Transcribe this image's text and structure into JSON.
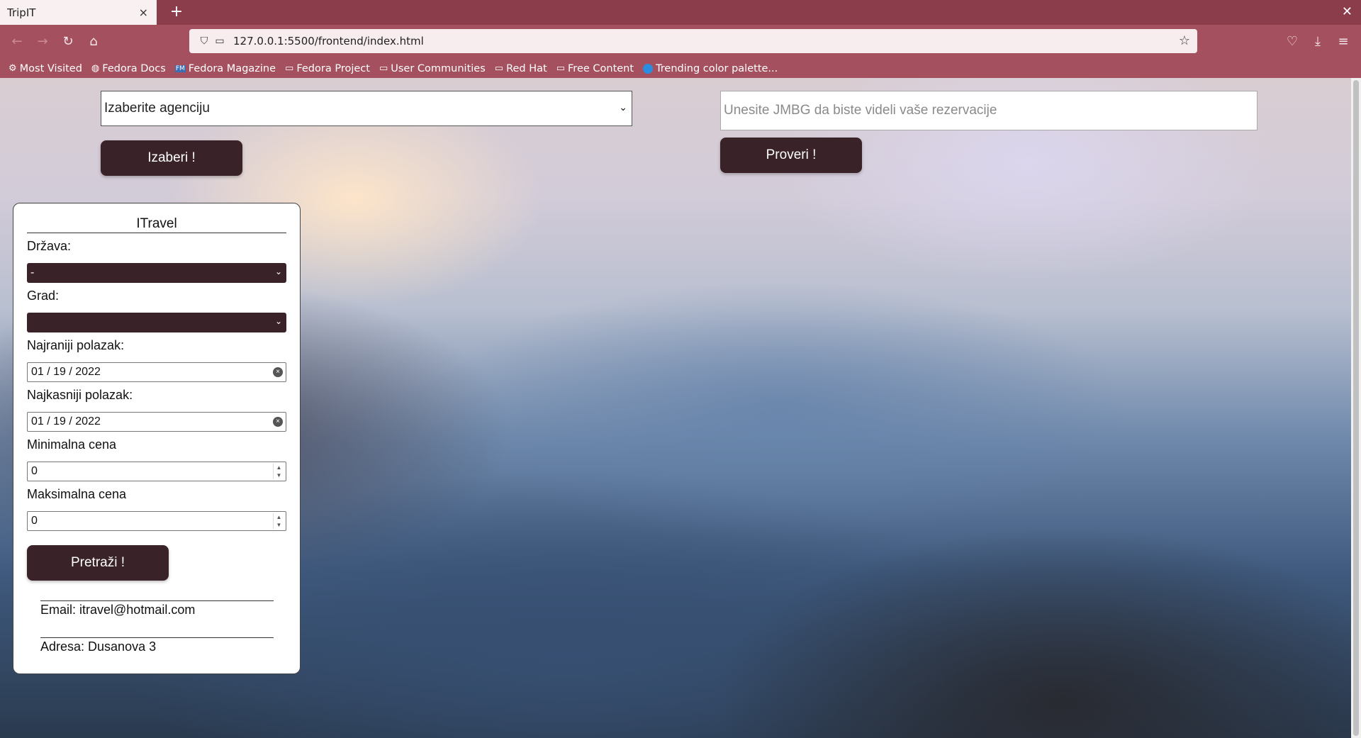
{
  "browser": {
    "tab_title": "TripIT",
    "tab_close": "×",
    "new_tab": "+",
    "window_close": "✕",
    "url": "127.0.0.1:5500/frontend/index.html",
    "bookmarks": [
      {
        "label": "Most Visited",
        "icon": "gear-icon"
      },
      {
        "label": "Fedora Docs",
        "icon": "globe-icon"
      },
      {
        "label": "Fedora Magazine",
        "icon": "fm-icon"
      },
      {
        "label": "Fedora Project",
        "icon": "folder-icon"
      },
      {
        "label": "User Communities",
        "icon": "folder-icon"
      },
      {
        "label": "Red Hat",
        "icon": "folder-icon"
      },
      {
        "label": "Free Content",
        "icon": "folder-icon"
      },
      {
        "label": "Trending color palette...",
        "icon": "site-icon"
      }
    ]
  },
  "page": {
    "agency_select": {
      "selected": "Izaberite agenciju"
    },
    "select_button": "Izaberi !",
    "jmbg": {
      "placeholder": "Unesite JMBG da biste videli vaše rezervacije",
      "value": ""
    },
    "check_button": "Proveri !"
  },
  "card": {
    "title": "ITravel",
    "country_label": "Država:",
    "country_value": "-",
    "city_label": "Grad:",
    "city_value": "",
    "earliest_label": "Najraniji polazak:",
    "earliest_value": "01 / 19 / 2022",
    "latest_label": "Najkasniji polazak:",
    "latest_value": "01 / 19 / 2022",
    "min_price_label": "Minimalna cena",
    "min_price_value": "0",
    "max_price_label": "Maksimalna cena",
    "max_price_value": "0",
    "search_button": "Pretraži !",
    "email": "Email: itravel@hotmail.com",
    "address": "Adresa: Dusanova 3"
  },
  "colors": {
    "chrome_tabbar": "#8b3d4c",
    "chrome_toolbar": "#a5505f",
    "button_bg": "#3a2229"
  }
}
